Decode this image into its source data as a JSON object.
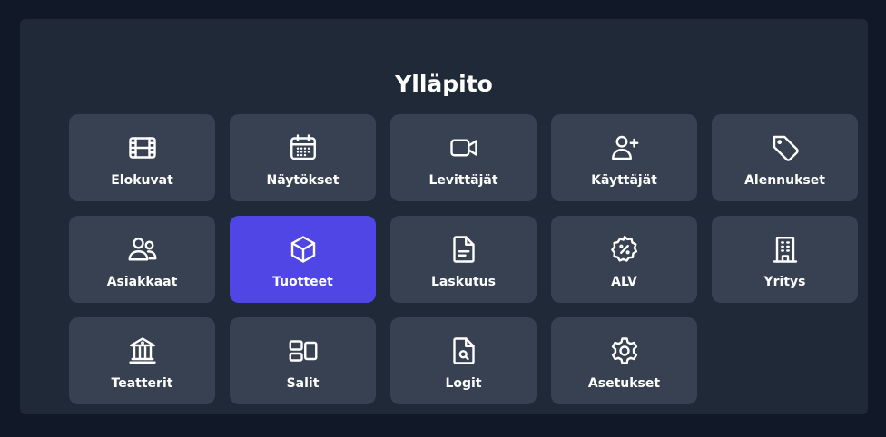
{
  "page": {
    "title": "Ylläpito"
  },
  "colors": {
    "background": "#111827",
    "panel": "#1f2937",
    "tile": "#374151",
    "tile_active": "#4f46e5",
    "text": "#ffffff"
  },
  "tiles": [
    {
      "label": "Elokuvat",
      "icon": "film-icon",
      "active": false
    },
    {
      "label": "Näytökset",
      "icon": "calendar-icon",
      "active": false
    },
    {
      "label": "Levittäjät",
      "icon": "video-camera-icon",
      "active": false
    },
    {
      "label": "Käyttäjät",
      "icon": "user-plus-icon",
      "active": false
    },
    {
      "label": "Alennukset",
      "icon": "tag-icon",
      "active": false
    },
    {
      "label": "Asiakkaat",
      "icon": "users-icon",
      "active": false
    },
    {
      "label": "Tuotteet",
      "icon": "cube-icon",
      "active": true
    },
    {
      "label": "Laskutus",
      "icon": "document-text-icon",
      "active": false
    },
    {
      "label": "ALV",
      "icon": "percent-badge-icon",
      "active": false
    },
    {
      "label": "Yritys",
      "icon": "building-icon",
      "active": false
    },
    {
      "label": "Teatterit",
      "icon": "building-library-icon",
      "active": false
    },
    {
      "label": "Salit",
      "icon": "squares-icon",
      "active": false
    },
    {
      "label": "Logit",
      "icon": "document-search-icon",
      "active": false
    },
    {
      "label": "Asetukset",
      "icon": "cog-icon",
      "active": false
    }
  ]
}
